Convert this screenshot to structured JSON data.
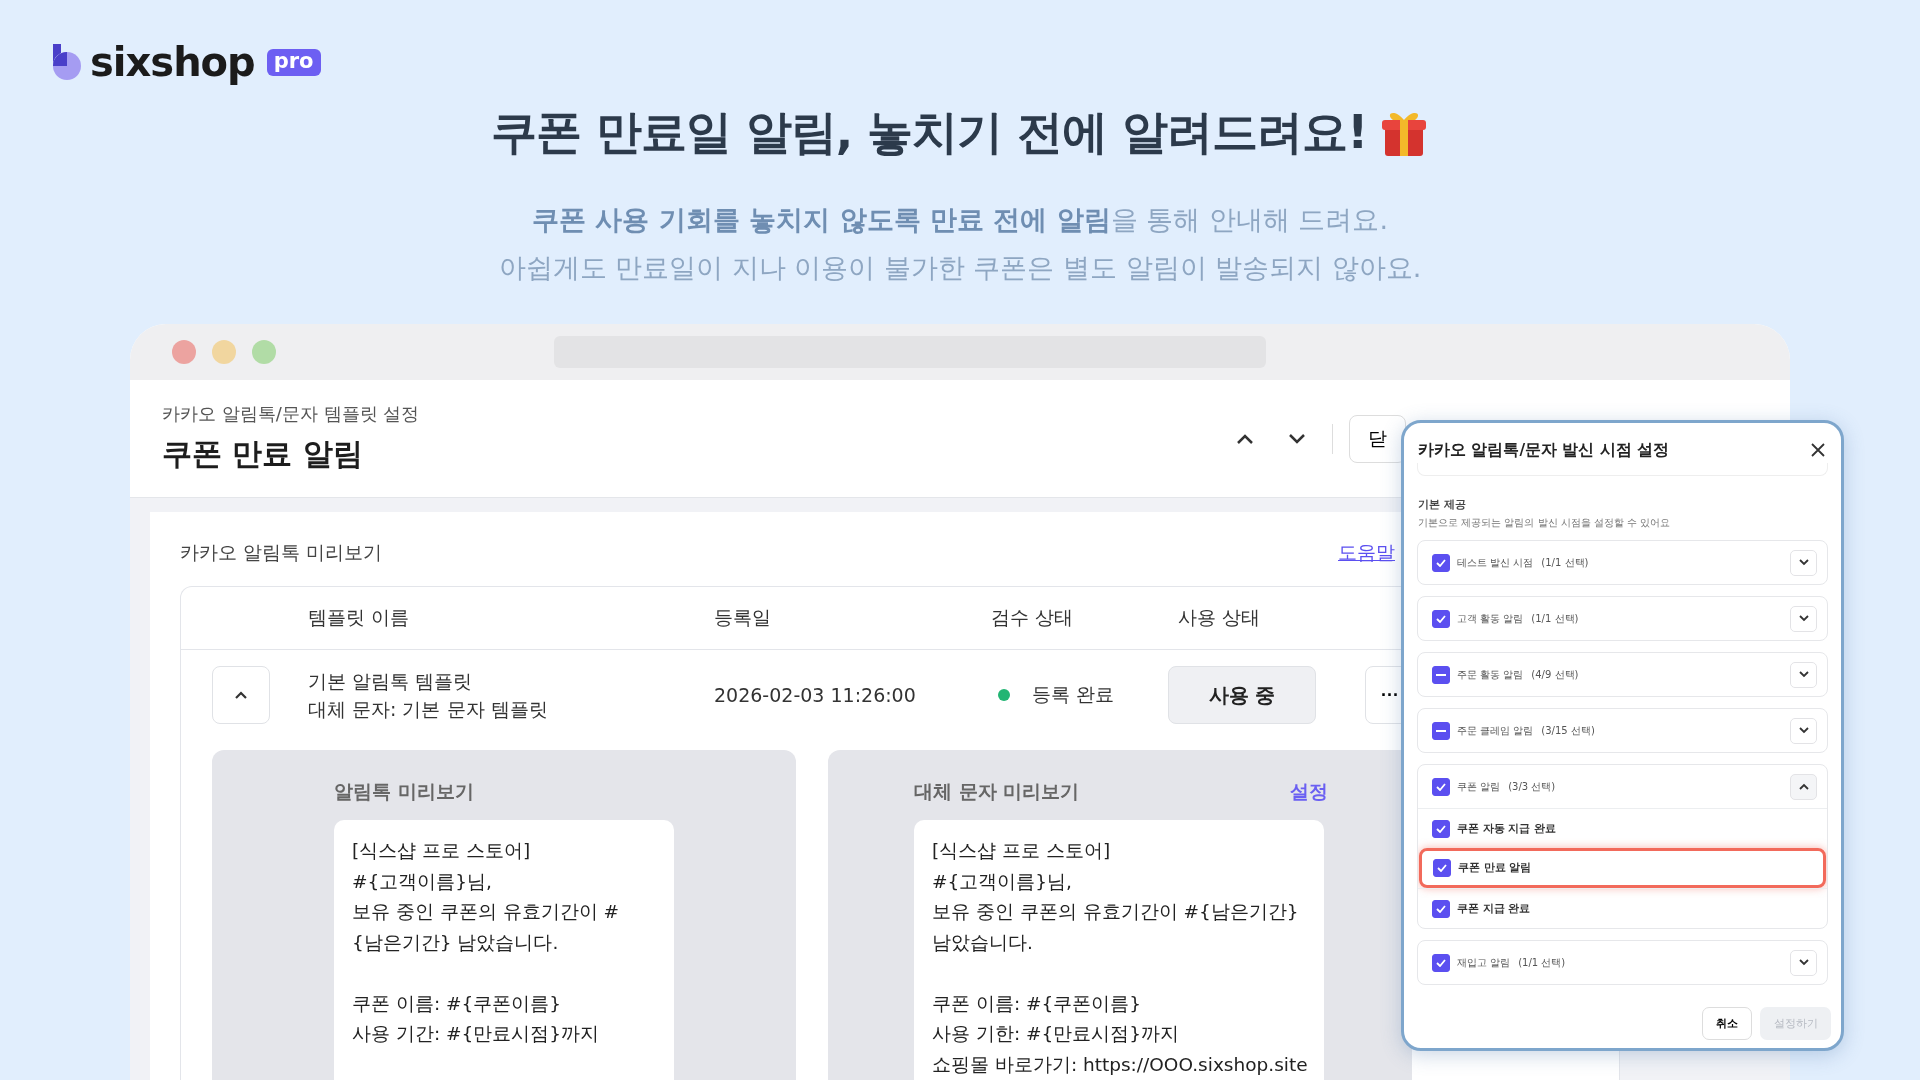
{
  "brand": {
    "name": "sixshop",
    "badge": "pro"
  },
  "headline": "쿠폰 만료일 알림, 놓치기 전에 알려드려요!",
  "subtitle": [
    "**쿠폰 사용 기회를 놓치지 않도록 만료 전에 알림**을 통해 안내해 드려요.",
    "아쉽게도 만료일이 지나 이용이 불가한 쿠폰은 별도 알림이 발송되지 않아요."
  ],
  "window": {
    "breadcrumb": "카카오 알림톡/문자 템플릿 설정",
    "title": "쿠폰 만료 알림",
    "close_button": "닫"
  },
  "preview_section": {
    "title": "카카오 알림톡 미리보기",
    "help_link": "도움말",
    "columns": [
      "템플릿 이름",
      "등록일",
      "검수 상태",
      "사용 상태"
    ],
    "row": {
      "expanded": true,
      "name": "기본 알림톡 템플릿",
      "fallback": "대체 문자: 기본 문자 템플릿",
      "date": "2026-02-03 11:26:00",
      "review_status": "등록 완료",
      "usage": "사용 중",
      "more": "···"
    }
  },
  "previews": [
    {
      "title": "알림톡 미리보기",
      "message": "[식스샵 프로 스토어]\n#{고객이름}님,\n보유 중인 쿠폰의 유효기간이 #\n{남은기간} 남았습니다.\n\n쿠폰 이름: #{쿠폰이름}\n사용 기간: #{만료시점}까지"
    },
    {
      "title": "대체 문자 미리보기",
      "action": "설정",
      "message": "[식스샵 프로 스토어]\n#{고객이름}님,\n보유 중인 쿠폰의 유효기간이 #{남은기간}\n남았습니다.\n\n쿠폰 이름: #{쿠폰이름}\n사용 기한: #{만료시점}까지\n쇼핑몰 바로가기: https://OOO.sixshop.site"
    }
  ],
  "modal": {
    "title": "카카오 알림톡/문자 발신 시점 설정",
    "section_title": "기본 제공",
    "section_desc": "기본으로 제공되는 알림의 발신 시점을 설정할 수 있어요",
    "groups": [
      {
        "label": "테스트 발신 시점",
        "count": "(1/1 선택)",
        "checked": true,
        "expanded": false
      },
      {
        "label": "고객 활동 알림",
        "count": "(1/1 선택)",
        "checked": true,
        "expanded": false
      },
      {
        "label": "주문 활동 알림",
        "count": "(4/9 선택)",
        "indeterminate": true,
        "expanded": false
      },
      {
        "label": "주문 클레임 알림",
        "count": "(3/15 선택)",
        "indeterminate": true,
        "expanded": false
      },
      {
        "label": "쿠폰 알림",
        "count": "(3/3 선택)",
        "checked": true,
        "expanded": true,
        "children": [
          {
            "label": "쿠폰 자동 지급 완료",
            "checked": true,
            "highlighted": false
          },
          {
            "label": "쿠폰 만료 알림",
            "checked": true,
            "highlighted": true
          },
          {
            "label": "쿠폰 지급 완료",
            "checked": true,
            "highlighted": false
          }
        ]
      },
      {
        "label": "재입고 알림",
        "count": "(1/1 선택)",
        "checked": true,
        "expanded": false
      }
    ],
    "cancel_button": "취소",
    "confirm_button": {
      "label": "설정하기",
      "disabled": true
    }
  }
}
